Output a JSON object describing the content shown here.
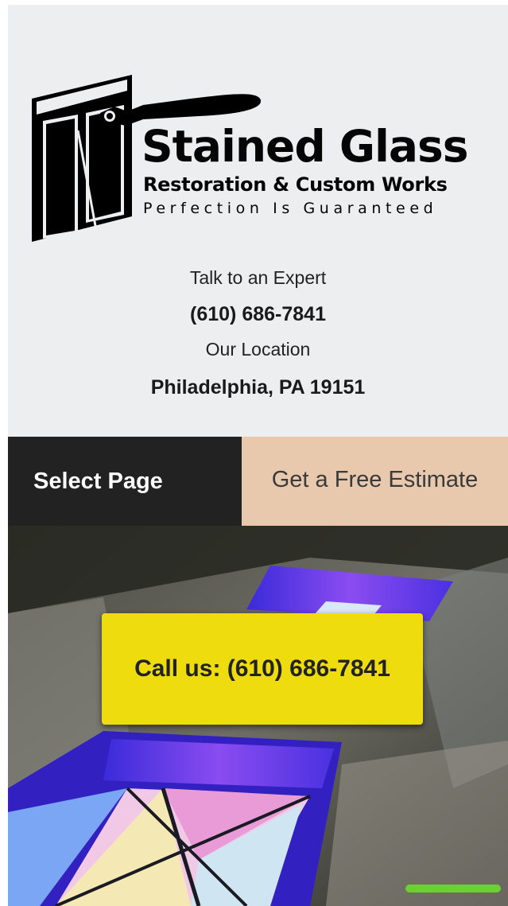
{
  "header": {
    "logo": {
      "title": "Stained Glass",
      "subtitle": "Restoration & Custom Works",
      "tagline": "Perfection Is Guaranteed"
    },
    "contact": {
      "expert_label": "Talk to an Expert",
      "phone": "(610) 686-7841",
      "location_label": "Our Location",
      "location": "Philadelphia, PA 19151"
    }
  },
  "nav": {
    "select_page": "Select Page",
    "estimate_cta": "Get a Free Estimate"
  },
  "hero": {
    "call_button": "Call us: (610) 686-7841",
    "accent_color": "#eedc0f",
    "slider_indicator_color": "#6ad12f"
  },
  "colors": {
    "header_bg": "#eceef0",
    "nav_dark": "#222222",
    "nav_estimate": "#e9c9ad"
  }
}
